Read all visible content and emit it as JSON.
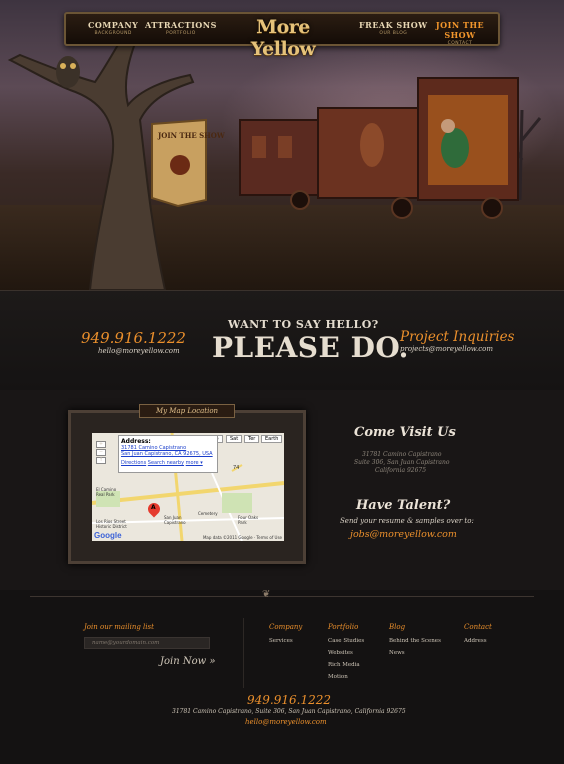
{
  "nav": {
    "items": [
      {
        "label": "COMPANY",
        "sub": "BACKGROUND"
      },
      {
        "label": "ATTRACTIONS",
        "sub": "PORTFOLIO"
      },
      {
        "label": "FREAK SHOW",
        "sub": "OUR BLOG"
      },
      {
        "label": "JOIN THE SHOW",
        "sub": "CONTACT"
      }
    ],
    "logo": "More Yellow"
  },
  "hero": {
    "sign_text": "JOIN THE SHOW"
  },
  "contact": {
    "phone": "949.916.1222",
    "email": "hello@moreyellow.com",
    "hello_pre": "WANT TO SAY HELLO?",
    "hello_main": "PLEASE DO.",
    "project_title": "Project Inquiries",
    "project_email": "projects@moreyellow.com"
  },
  "map": {
    "label": "My Map Location",
    "tabs": [
      "Map",
      "Sat",
      "Ter",
      "Earth"
    ],
    "bubble_title": "Address:",
    "bubble_line1": "31781 Camino Capistrano",
    "bubble_line2": "San Juan Capistrano, CA 92675, USA",
    "bubble_links": [
      "Directions",
      "Search nearby",
      "more ▾"
    ],
    "zoom": [
      "+",
      "−",
      "↑",
      "↓"
    ],
    "footer": "Map data ©2011 Google · Terms of Use",
    "google": "Google",
    "places": [
      "El Camino Real Park",
      "Los Rios Street Historic District",
      "San Juan Capistrano",
      "Cemetery",
      "Four Oaks Park"
    ],
    "marker": "A",
    "road_label": "74"
  },
  "visit": {
    "title": "Come Visit Us",
    "lines": [
      "31781 Camino Capistrano",
      "Suite 306, San Juan Capistrano",
      "California 92675"
    ]
  },
  "talent": {
    "title": "Have Talent?",
    "subtitle": "Send your resume & samples over to:",
    "email": "jobs@moreyellow.com"
  },
  "footer": {
    "mailing_title": "Join our mailing list",
    "mailing_placeholder": "name@yourdomain.com",
    "join_label": "Join Now »",
    "columns": [
      {
        "title": "Company",
        "links": [
          "Services"
        ]
      },
      {
        "title": "Portfolio",
        "links": [
          "Case Studies",
          "Websites",
          "Rich Media",
          "Motion"
        ]
      },
      {
        "title": "Blog",
        "links": [
          "Behind the Scenes",
          "News"
        ]
      },
      {
        "title": "Contact",
        "links": [
          "Address"
        ]
      }
    ],
    "phone": "949.916.1222",
    "address": "31781 Camino Capistrano, Suite 306, San Juan Capistrano, California 92675",
    "email": "hello@moreyellow.com"
  },
  "colors": {
    "accent": "#ea8f2c",
    "background": "#141212",
    "text": "#cfc6b8"
  }
}
